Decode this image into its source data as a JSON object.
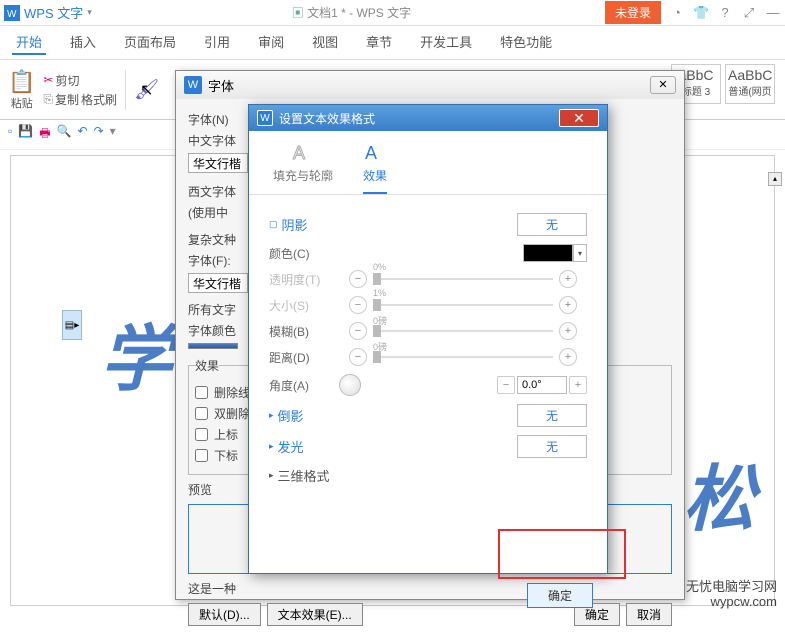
{
  "titlebar": {
    "app": "WPS 文字",
    "doc": "文档1 * - WPS 文字",
    "not_logged": "未登录"
  },
  "ribbon": {
    "tabs": [
      "开始",
      "插入",
      "页面布局",
      "引用",
      "审阅",
      "视图",
      "章节",
      "开发工具",
      "特色功能"
    ],
    "paste": "粘贴",
    "cut": "剪切",
    "copy": "复制",
    "fmt": "格式刷",
    "style1": {
      "aa": "aBbC",
      "name": "标题 3"
    },
    "style2": {
      "aa": "AaBbC",
      "name": "普通(网页"
    }
  },
  "font_dialog": {
    "title": "字体",
    "font_n": "字体(N)",
    "cn_font": "中文字体",
    "cn_val": "华文行楷",
    "west_font": "西文字体",
    "use_cn": "(使用中",
    "complex": "复杂文种",
    "font_f": "字体(F):",
    "complex_val": "华文行楷",
    "all_text": "所有文字",
    "font_color": "字体颜色",
    "effects": "效果",
    "strike": "删除线",
    "dbl_strike": "双删除",
    "super": "上标",
    "sub": "下标",
    "preview": "预览",
    "desc": "这是一种",
    "default": "默认(D)...",
    "text_effect": "文本效果(E)...",
    "ok": "确定",
    "cancel": "取消"
  },
  "effect_dialog": {
    "title": "设置文本效果格式",
    "tab1": "填充与轮廓",
    "tab2": "效果",
    "shadow": "阴影",
    "none": "无",
    "color": "颜色(C)",
    "transparency": "透明度(T)",
    "size": "大小(S)",
    "blur": "模糊(B)",
    "distance": "距离(D)",
    "angle": "角度(A)",
    "angle_val": "0.0°",
    "reflection": "倒影",
    "glow": "发光",
    "three_d": "三维格式",
    "ok": "确定",
    "t_val": "0%",
    "s_val": "1%",
    "b_val": "0磅",
    "d_val": "0磅"
  },
  "watermark": {
    "l1": "无忧电脑学习网",
    "l2": "wypcw.com"
  },
  "sample": "学"
}
